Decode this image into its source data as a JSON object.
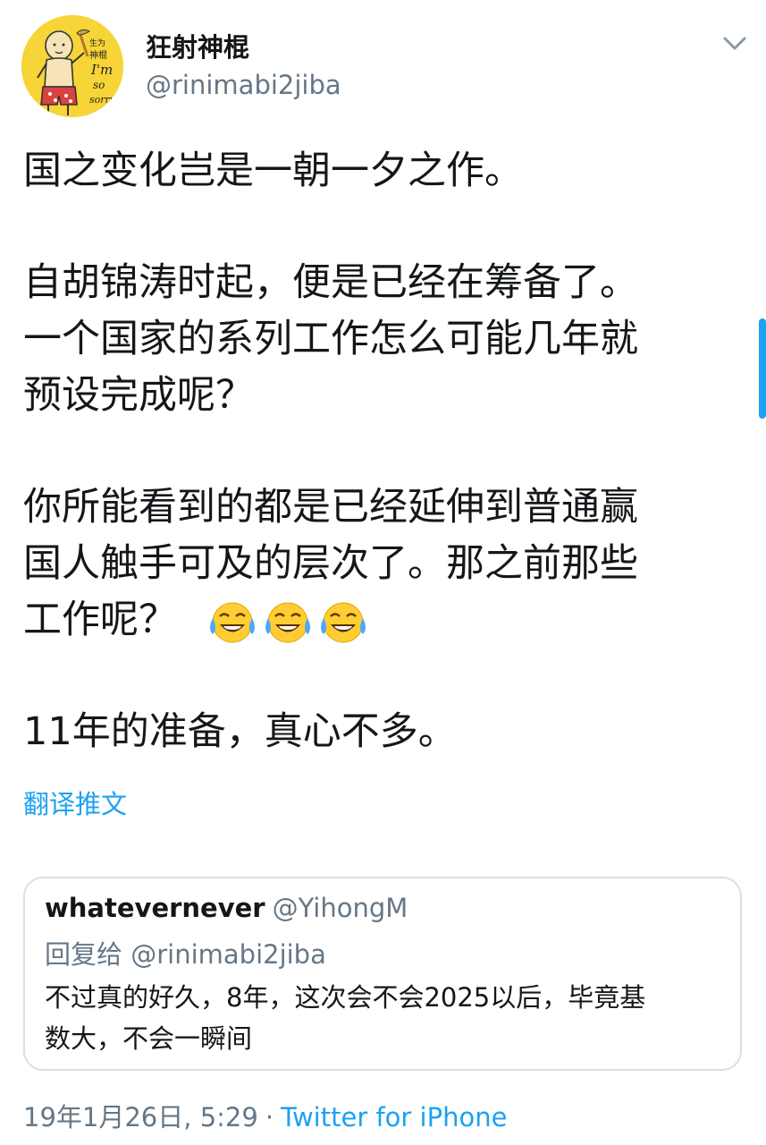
{
  "author": {
    "display_name": "狂射神棍",
    "handle": "@rinimabi2jiba",
    "avatar_text": [
      "生为",
      "神棍",
      "I'm",
      "so",
      "sorry"
    ]
  },
  "tweet": {
    "paragraphs": [
      [
        "国之变化岂是一朝一夕之作。"
      ],
      [
        "自胡锦涛时起，便是已经在筹备了。",
        "一个国家的系列工作怎么可能几年就",
        "预设完成呢？"
      ],
      [
        "你所能看到的都是已经延伸到普通赢",
        "国人触手可及的层次了。那之前那些"
      ],
      [
        "11年的准备，真心不多。"
      ]
    ],
    "emoji_line_text": "工作呢？",
    "emoji": [
      "face-with-tears-of-joy",
      "face-with-tears-of-joy",
      "face-with-tears-of-joy"
    ]
  },
  "translate_label": "翻译推文",
  "quote": {
    "author_name": "whatevernever",
    "author_handle": "@YihongM",
    "reply_to": "回复给 @rinimabi2jiba",
    "text_lines": [
      "不过真的好久，8年，这次会不会2025以后，毕竟基",
      "数大，不会一瞬间"
    ]
  },
  "meta": {
    "timestamp": "19年1月26日, 5:29",
    "separator": "·",
    "source": "Twitter for iPhone"
  },
  "colors": {
    "text": "#14171a",
    "secondary": "#657786",
    "accent": "#1da1f2",
    "border": "#d8dfe5",
    "avatar_bg": "#f7d437"
  },
  "icons": {
    "menu": "chevron-down-icon",
    "emoji": "tears-of-joy-emoji"
  }
}
